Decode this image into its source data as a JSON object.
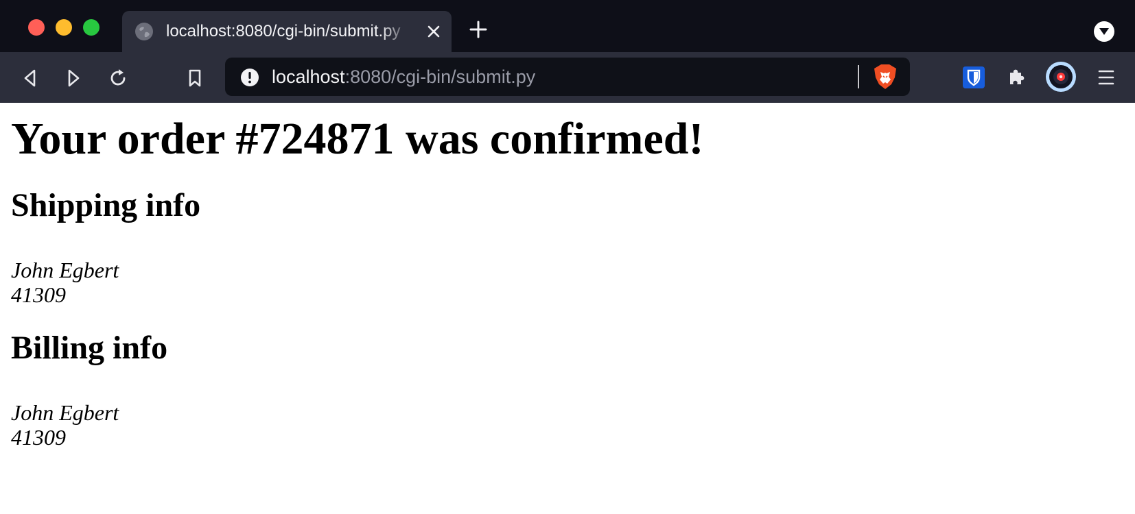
{
  "browser": {
    "tab": {
      "title": "localhost:8080/cgi-bin/submit.py"
    },
    "address_bar": {
      "host": "localhost",
      "path": ":8080/cgi-bin/submit.py"
    },
    "icons": {
      "favicon": "globe-icon",
      "close": "close-icon",
      "new_tab": "plus-icon",
      "tab_menu": "chevron-down-icon",
      "back": "back-icon",
      "forward": "forward-icon",
      "reload": "reload-icon",
      "bookmark": "bookmark-icon",
      "site_info": "warning-icon",
      "shields": "brave-lion-icon",
      "extension_1": "bitwarden-shield-icon",
      "extensions": "puzzle-icon",
      "profile": "avatar",
      "menu": "hamburger-icon"
    },
    "colors": {
      "tabbar_bg": "#0e0f18",
      "toolbar_bg": "#2c2e3b",
      "urlbar_bg": "#0f1118",
      "brave_orange": "#f04e23",
      "bitwarden_blue": "#175ddc"
    }
  },
  "page": {
    "heading": "Your order #724871 was confirmed!",
    "shipping": {
      "heading": "Shipping info",
      "name": "John Egbert",
      "zip": "41309"
    },
    "billing": {
      "heading": "Billing info",
      "name": "John Egbert",
      "zip": "41309"
    }
  }
}
